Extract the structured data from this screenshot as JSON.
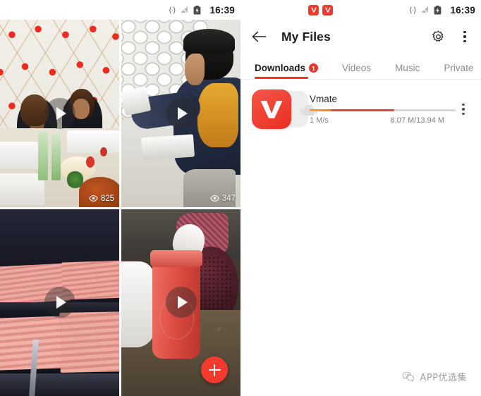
{
  "left_panel": {
    "status_bar": {
      "usb_icon": "usb-data-icon",
      "signal_icon": "signal-off-icon",
      "battery_icon": "battery-charging-icon",
      "time": "16:39"
    },
    "videos": [
      {
        "id": "video-men-eating",
        "description": "Two men eating at a table inside a white tent with red dots",
        "views": "825",
        "play_icon": "play-icon",
        "eye_icon": "eye-icon"
      },
      {
        "id": "video-wall-plastering",
        "description": "Man applying textured plaster pattern to a wall",
        "views": "347",
        "play_icon": "play-icon",
        "eye_icon": "eye-icon"
      },
      {
        "id": "video-pink-sheets",
        "description": "Stacks of pink sheets on dark shelving",
        "views": "",
        "play_icon": "play-icon",
        "eye_icon": "eye-icon"
      },
      {
        "id": "video-pink-jar",
        "description": "Pink jar with foam on a kitchen counter",
        "views": "",
        "play_icon": "play-icon",
        "eye_icon": "eye-icon"
      }
    ],
    "fab": {
      "label": "+",
      "icon": "plus-icon",
      "color": "#f4392f"
    }
  },
  "right_panel": {
    "status_bar": {
      "notification_icons": [
        "vmate-notification-icon",
        "vmate-notification-icon"
      ],
      "usb_icon": "usb-data-icon",
      "signal_icon": "signal-off-icon",
      "battery_icon": "battery-charging-icon",
      "time": "16:39"
    },
    "appbar": {
      "back_icon": "back-arrow-icon",
      "title": "My Files",
      "settings_icon": "gear-icon",
      "overflow_icon": "more-vertical-icon"
    },
    "tabs": [
      {
        "label": "Downloads",
        "active": true,
        "badge": "1"
      },
      {
        "label": "Videos",
        "active": false,
        "badge": ""
      },
      {
        "label": "Music",
        "active": false,
        "badge": ""
      },
      {
        "label": "Private",
        "active": false,
        "badge": ""
      }
    ],
    "downloads": [
      {
        "name": "Vmate",
        "app_icon": "vmate-app-icon",
        "speed": "1 M/s",
        "size": "8.07 M/13.94 M",
        "progress_percent": 58,
        "progress_orange_percent": 15,
        "overflow_icon": "more-vertical-icon"
      }
    ],
    "watermark": {
      "icon": "wechat-icon",
      "text": "APP优选集"
    }
  },
  "colors": {
    "accent_red": "#e8352a",
    "vmate_red": "#f4392f",
    "progress_orange": "#f5a623",
    "text_primary": "#1c1c1c",
    "text_muted": "#8c8c8c"
  }
}
